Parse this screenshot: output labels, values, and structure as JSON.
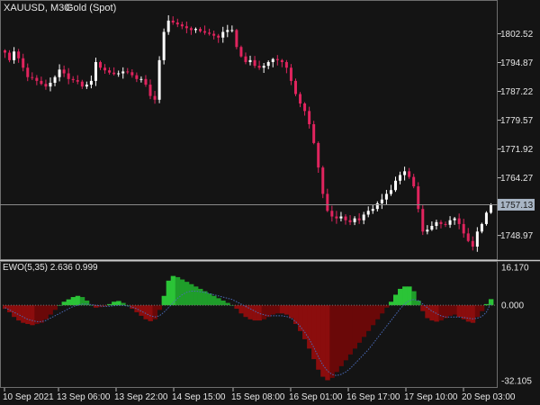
{
  "header": {
    "symbol": "XAUUSD, M30:",
    "instrument": "Gold (Spot)"
  },
  "indicator": {
    "label": "EWO(5,35) 2.636 0.999"
  },
  "colors": {
    "background": "#141414",
    "candle_up": "#ffffff",
    "candle_down": "#e0245e",
    "histogram_up": "#1f9d2a",
    "histogram_up_light": "#2bc437",
    "histogram_down": "#8b0d0d",
    "histogram_down_dark": "#6a0808",
    "signal_line": "#4a6ab8",
    "grid": "#8a8a8a",
    "price_tag_bg": "#a8b5c4"
  },
  "chart_data": [
    {
      "type": "candlestick",
      "title": "XAUUSD, M30: Gold (Spot)",
      "y_ticks": [
        "1802.52",
        "1794.87",
        "1787.22",
        "1779.57",
        "1771.92",
        "1764.27",
        "1748.97"
      ],
      "y_tick_values": [
        1802.52,
        1794.87,
        1787.22,
        1779.57,
        1771.92,
        1764.27,
        1748.97
      ],
      "ylim": [
        1742.9,
        1811.0
      ],
      "current_price": "1757.13",
      "current_price_value": 1757.13,
      "x_ticks": [
        "10 Sep 2021",
        "13 Sep 06:00",
        "13 Sep 22:00",
        "14 Sep 15:00",
        "15 Sep 08:00",
        "16 Sep 01:00",
        "16 Sep 17:00",
        "17 Sep 10:00",
        "20 Sep 03:00"
      ],
      "close_path": [
        1797.5,
        1795.5,
        1797.8,
        1796.0,
        1793.5,
        1791.0,
        1790.8,
        1790.0,
        1789.2,
        1788.5,
        1789.5,
        1791.0,
        1793.0,
        1792.0,
        1790.5,
        1790.2,
        1789.8,
        1788.5,
        1789.0,
        1790.0,
        1795.0,
        1793.5,
        1792.8,
        1792.2,
        1791.8,
        1792.0,
        1792.5,
        1792.3,
        1791.5,
        1790.5,
        1790.5,
        1789.0,
        1786.0,
        1785.0,
        1795.5,
        1803.0,
        1806.0,
        1805.5,
        1805.0,
        1804.5,
        1804.0,
        1803.5,
        1803.8,
        1803.2,
        1802.8,
        1802.5,
        1802.0,
        1801.5,
        1803.0,
        1803.5,
        1803.5,
        1799.0,
        1796.5,
        1795.0,
        1795.5,
        1794.0,
        1793.5,
        1794.0,
        1795.0,
        1795.8,
        1795.5,
        1795.0,
        1793.5,
        1790.0,
        1786.5,
        1784.0,
        1782.0,
        1778.5,
        1773.5,
        1767.0,
        1760.0,
        1755.5,
        1754.0,
        1753.5,
        1754.0,
        1753.0,
        1752.5,
        1753.5,
        1753.0,
        1754.5,
        1755.5,
        1756.0,
        1757.5,
        1758.5,
        1760.0,
        1761.0,
        1763.5,
        1765.0,
        1766.0,
        1764.5,
        1762.0,
        1756.0,
        1750.0,
        1750.5,
        1751.5,
        1752.5,
        1752.0,
        1751.8,
        1753.0,
        1753.5,
        1752.0,
        1749.5,
        1747.5,
        1746.0,
        1750.0,
        1752.0,
        1755.0,
        1757.1
      ],
      "ewo_label": "EWO(5,35) 2.636 0.999",
      "ewo_y_ticks": [
        "16.170",
        "0.000",
        "-32.105"
      ],
      "ewo_y_tick_values": [
        16.17,
        0.0,
        -32.105
      ],
      "ewo_ylim": [
        -34.5,
        18.5
      ],
      "ewo_values": [
        -1.5,
        -3.0,
        -5.0,
        -6.5,
        -7.5,
        -8.0,
        -8.5,
        -8.0,
        -7.5,
        -6.0,
        -4.0,
        -2.0,
        0.0,
        1.5,
        2.5,
        3.5,
        4.0,
        3.5,
        2.0,
        0.0,
        -1.0,
        -0.8,
        -0.5,
        0.5,
        1.5,
        1.8,
        1.0,
        0.0,
        -1.5,
        -3.0,
        -4.5,
        -6.0,
        -6.8,
        -6.0,
        -2.0,
        4.0,
        10.5,
        12.5,
        12.0,
        11.0,
        10.0,
        9.0,
        8.0,
        7.0,
        6.0,
        5.0,
        4.0,
        3.0,
        2.0,
        1.0,
        0.0,
        -1.5,
        -3.5,
        -5.0,
        -6.0,
        -6.5,
        -6.5,
        -6.0,
        -5.0,
        -4.0,
        -3.5,
        -3.5,
        -4.0,
        -5.5,
        -8.0,
        -11.0,
        -14.5,
        -18.5,
        -23.0,
        -27.5,
        -30.5,
        -32.0,
        -31.0,
        -28.5,
        -26.0,
        -23.5,
        -21.0,
        -18.5,
        -16.0,
        -13.5,
        -11.0,
        -8.5,
        -6.0,
        -3.5,
        -1.0,
        1.5,
        4.5,
        7.0,
        8.0,
        8.0,
        6.0,
        2.0,
        -2.5,
        -5.5,
        -6.5,
        -7.0,
        -6.5,
        -5.5,
        -4.5,
        -4.0,
        -5.0,
        -6.0,
        -7.0,
        -7.5,
        -5.0,
        -2.5,
        0.5,
        2.6
      ],
      "ewo_signal": [
        -1.0,
        -2.0,
        -3.0,
        -4.0,
        -5.0,
        -6.0,
        -6.5,
        -7.0,
        -7.0,
        -6.5,
        -5.5,
        -4.5,
        -3.5,
        -2.5,
        -1.5,
        -0.5,
        0.0,
        0.5,
        0.5,
        0.3,
        0.0,
        -0.3,
        -0.5,
        -0.4,
        -0.2,
        0.0,
        0.0,
        -0.3,
        -0.8,
        -1.5,
        -2.5,
        -3.5,
        -4.5,
        -5.0,
        -4.5,
        -3.0,
        -1.0,
        1.0,
        3.0,
        4.5,
        5.5,
        6.0,
        6.0,
        5.8,
        5.5,
        5.0,
        4.5,
        4.0,
        3.5,
        3.0,
        2.5,
        1.5,
        0.5,
        -0.5,
        -1.5,
        -2.5,
        -3.5,
        -4.0,
        -4.5,
        -4.5,
        -4.5,
        -4.5,
        -4.8,
        -5.5,
        -7.0,
        -9.0,
        -11.5,
        -14.5,
        -18.0,
        -22.0,
        -25.5,
        -28.0,
        -29.5,
        -30.0,
        -29.5,
        -28.5,
        -27.0,
        -25.0,
        -23.0,
        -21.0,
        -19.0,
        -16.5,
        -14.0,
        -11.5,
        -9.0,
        -6.5,
        -4.0,
        -1.5,
        0.5,
        2.0,
        2.5,
        2.0,
        0.5,
        -1.0,
        -2.5,
        -3.5,
        -4.5,
        -5.0,
        -5.0,
        -5.0,
        -5.0,
        -5.2,
        -5.5,
        -5.8,
        -5.5,
        -4.8,
        -3.0,
        1.0
      ]
    }
  ]
}
